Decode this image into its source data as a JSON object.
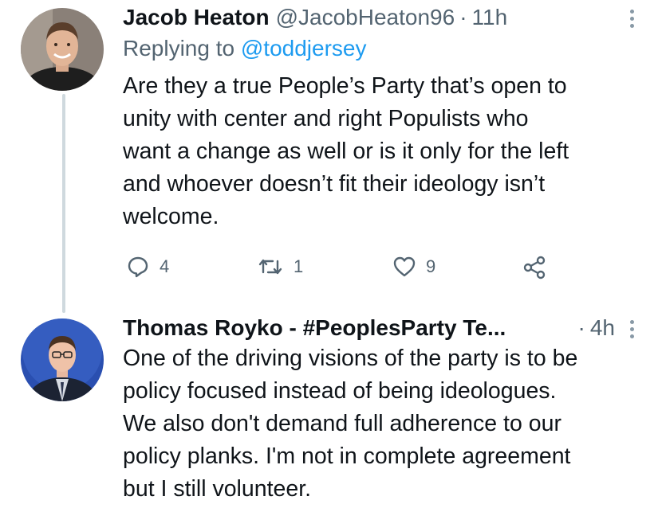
{
  "tweet1": {
    "name": "Jacob Heaton",
    "handle": "@JacobHeaton96",
    "separator": "·",
    "time": "11h",
    "replying_prefix": "Replying to",
    "replying_mention": "@toddjersey",
    "text_lines": [
      "Are they a true People’s Party that’s open to",
      "unity with center and right Populists who",
      "want a change as well or is it only for the left",
      "and whoever doesn’t fit their ideology isn’t",
      "welcome."
    ],
    "actions": {
      "reply_count": "4",
      "retweet_count": "1",
      "like_count": "9"
    }
  },
  "tweet2": {
    "name": "Thomas Royko - #PeoplesParty Te...",
    "separator": "·",
    "time": "4h",
    "text_lines": [
      "One of the driving visions of the party is to be",
      "policy focused instead of being ideologues.",
      "We also don't demand full adherence to our",
      "policy planks. I'm not in complete agreement",
      "but I still volunteer."
    ]
  },
  "icons": {
    "reply": "reply-bubble-icon",
    "retweet": "retweet-icon",
    "like": "heart-icon",
    "share": "share-icon",
    "more": "vertical-dots-icon"
  },
  "colors": {
    "text": "#0f1419",
    "secondary": "#536471",
    "link": "#1d9bf0",
    "thread_line": "#cfd9de"
  }
}
